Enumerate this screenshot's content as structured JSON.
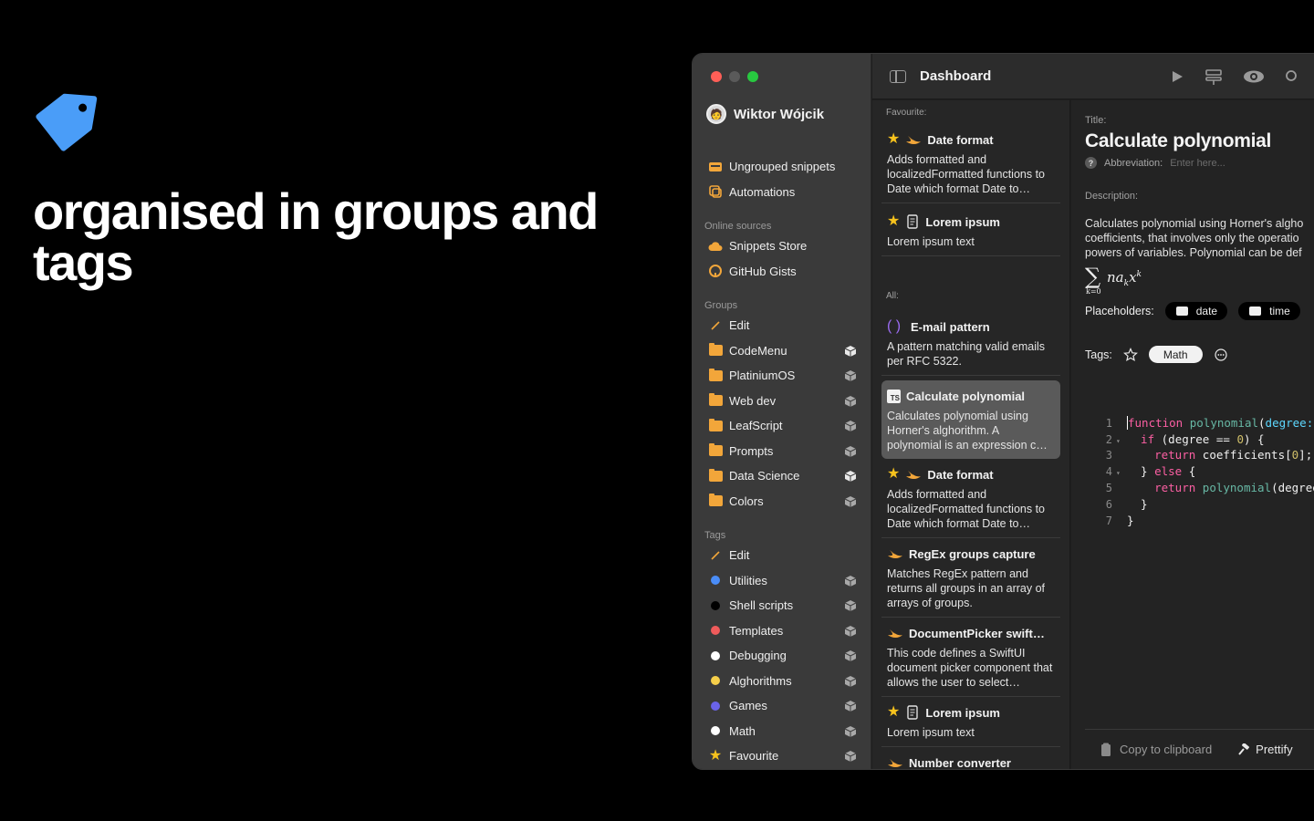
{
  "hero": {
    "title": "organised in groups and tags",
    "tag_color": "#4a9df8"
  },
  "window": {
    "user_name": "Wiktor Wójcik",
    "header_title": "Dashboard"
  },
  "sidebar": {
    "top_items": [
      {
        "label": "Ungrouped snippets",
        "icon": "tray-icon"
      },
      {
        "label": "Automations",
        "icon": "automation-icon"
      }
    ],
    "online_sources_label": "Online sources",
    "online_sources": [
      {
        "label": "Snippets Store",
        "icon": "cloud-icon"
      },
      {
        "label": "GitHub Gists",
        "icon": "github-icon"
      }
    ],
    "groups_label": "Groups",
    "groups_edit": "Edit",
    "groups": [
      {
        "label": "CodeMenu"
      },
      {
        "label": "PlatiniumOS"
      },
      {
        "label": "Web dev"
      },
      {
        "label": "LeafScript"
      },
      {
        "label": "Prompts"
      },
      {
        "label": "Data Science"
      },
      {
        "label": "Colors"
      }
    ],
    "tags_label": "Tags",
    "tags_edit": "Edit",
    "tags": [
      {
        "label": "Utilities",
        "color": "#4a8df8"
      },
      {
        "label": "Shell scripts",
        "color": "#000000"
      },
      {
        "label": "Templates",
        "color": "#ef5b5b"
      },
      {
        "label": "Debugging",
        "color": "#ffffff"
      },
      {
        "label": "Alghorithms",
        "color": "#f6cf4a"
      },
      {
        "label": "Games",
        "color": "#6a63e8"
      },
      {
        "label": "Math",
        "color": "#ffffff"
      },
      {
        "label": "Favourite",
        "color": "#f6c21d",
        "icon": "star-icon"
      }
    ]
  },
  "list": {
    "favourite_label": "Favourite:",
    "all_label": "All:",
    "favourites": [
      {
        "title": "Date format",
        "desc": "Adds formatted and localizedFormatted functions to Date which format Date to…",
        "icon": "swift-icon",
        "starred": true
      },
      {
        "title": "Lorem ipsum",
        "desc": "Lorem ipsum text",
        "icon": "document-icon",
        "starred": true
      }
    ],
    "all": [
      {
        "title": "E-mail pattern",
        "desc": "A pattern matching valid emails per RFC 5322.",
        "icon": "regex-icon",
        "starred": false
      },
      {
        "title": "Calculate polynomial",
        "desc": "Calculates polynomial using Horner's alghorithm. A polynomial is an expression c…",
        "icon": "typescript-icon",
        "starred": false,
        "selected": true
      },
      {
        "title": "Date format",
        "desc": "Adds formatted and localizedFormatted functions to Date which format Date to…",
        "icon": "swift-icon",
        "starred": true
      },
      {
        "title": "RegEx groups capture",
        "desc": "Matches RegEx pattern and returns all groups in an array of arrays of groups.",
        "icon": "swift-icon",
        "starred": false
      },
      {
        "title": "DocumentPicker swift…",
        "desc": "This code defines a SwiftUI document picker component that allows the user to select…",
        "icon": "swift-icon",
        "starred": false
      },
      {
        "title": "Lorem ipsum",
        "desc": "Lorem ipsum text",
        "icon": "document-icon",
        "starred": true
      },
      {
        "title": "Number converter",
        "desc": "",
        "icon": "swift-icon",
        "starred": false
      }
    ]
  },
  "detail": {
    "title_label": "Title:",
    "title": "Calculate polynomial",
    "abbreviation_label": "Abbreviation:",
    "abbreviation_placeholder": "Enter here...",
    "description_label": "Description:",
    "description_lines": [
      "Calculates polynomial using Horner's algho",
      "coefficients, that involves only the operatio",
      "powers of variables. Polynomial can be def"
    ],
    "formula": "∑ na_k x^k",
    "formula_sub": "k=0",
    "placeholders_label": "Placeholders:",
    "placeholders": [
      "date",
      "time"
    ],
    "tags_label": "Tags:",
    "tags": [
      "Math"
    ],
    "code_lines": [
      "function polynomial(degree:",
      "    if (degree == 0) {",
      "      return coefficients[0];",
      "    } else {",
      "      return polynomial(degree",
      "    }",
      "}"
    ],
    "copy_label": "Copy to clipboard",
    "prettify_label": "Prettify"
  }
}
